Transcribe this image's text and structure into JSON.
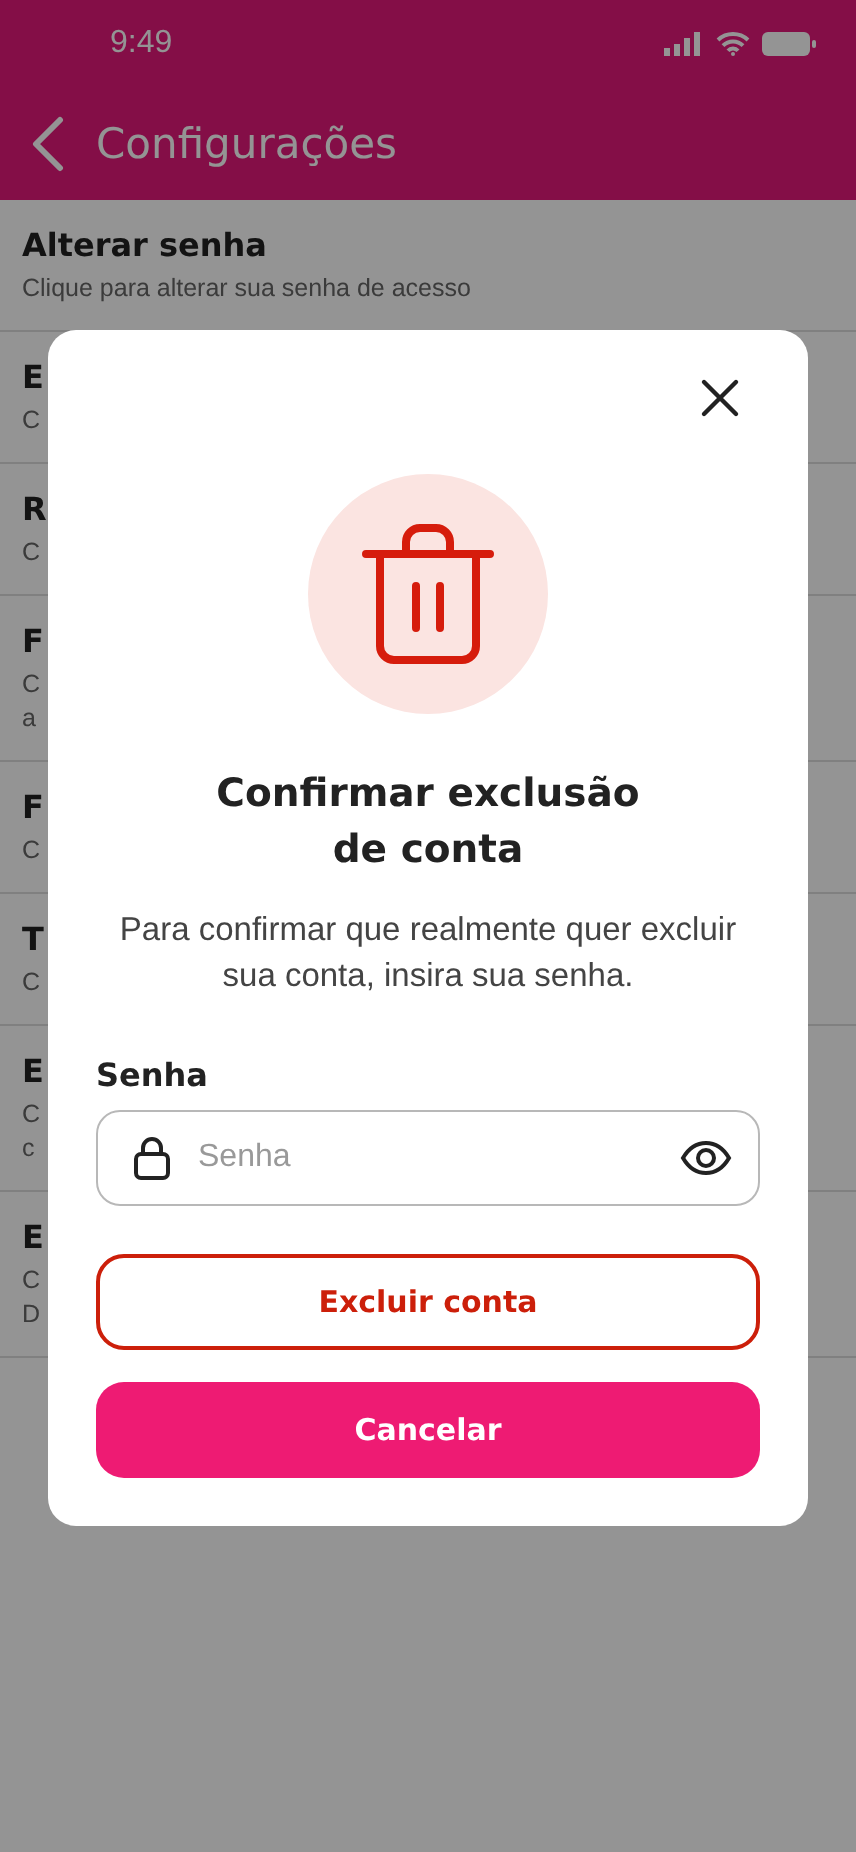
{
  "status_bar": {
    "time": "9:49"
  },
  "header": {
    "title": "Configurações"
  },
  "settings": [
    {
      "title": "Alterar senha",
      "subtitle": [
        "Clique para alterar sua senha de acesso"
      ]
    },
    {
      "title": "E",
      "subtitle": [
        "C"
      ]
    },
    {
      "title": "R",
      "subtitle": [
        "C"
      ]
    },
    {
      "title": "F",
      "subtitle": [
        "C",
        "a"
      ]
    },
    {
      "title": "F",
      "subtitle": [
        "C"
      ]
    },
    {
      "title": "T",
      "subtitle": [
        "C"
      ]
    },
    {
      "title": "E",
      "subtitle": [
        "C",
        "c"
      ]
    },
    {
      "title": "E",
      "subtitle": [
        "C",
        "D"
      ]
    }
  ],
  "dialog": {
    "title": "Confirmar exclusão de conta",
    "message": "Para confirmar que realmente quer excluir sua conta, insira sua senha.",
    "password": {
      "label": "Senha",
      "placeholder": "Senha"
    },
    "buttons": [
      {
        "label": "Excluir conta",
        "kind": "outline"
      },
      {
        "label": "Cancelar",
        "kind": "filled"
      }
    ]
  }
}
